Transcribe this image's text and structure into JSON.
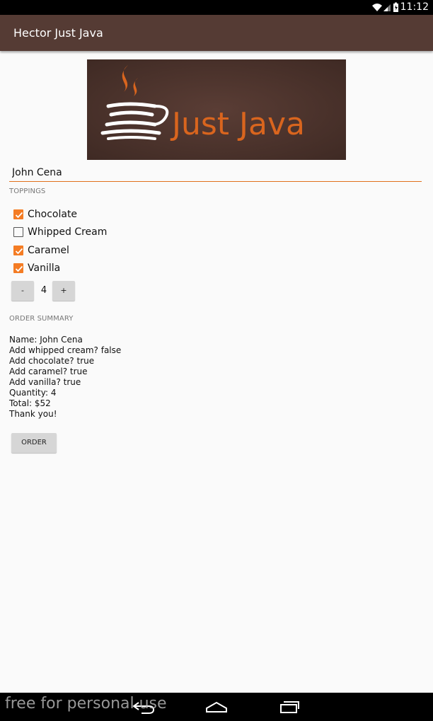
{
  "status_bar": {
    "time": "11:12",
    "icons": [
      "wifi-icon",
      "cell-signal-icon",
      "battery-icon"
    ]
  },
  "app_bar": {
    "title": "Hector Just Java",
    "color": "#553b34"
  },
  "logo": {
    "text": "Just Java",
    "icon": "coffee-cup-icon"
  },
  "name_input": {
    "value": "John Cena",
    "accent": "#e0701c"
  },
  "toppings": {
    "header": "TOPPINGS",
    "items": [
      {
        "label": "Chocolate",
        "checked": true
      },
      {
        "label": "Whipped Cream",
        "checked": false
      },
      {
        "label": "Caramel",
        "checked": true
      },
      {
        "label": "Vanilla",
        "checked": true
      }
    ]
  },
  "quantity": {
    "decrement_label": "-",
    "value": "4",
    "increment_label": "+"
  },
  "order_summary": {
    "header": "ORDER SUMMARY",
    "lines": [
      "Name: John Cena",
      "Add whipped cream? false",
      "Add chocolate? true",
      "Add caramel? true",
      "Add vanilla? true",
      "Quantity: 4",
      "Total: $52",
      "Thank you!"
    ]
  },
  "order_button": {
    "label": "ORDER"
  },
  "nav_bar": {
    "icons": [
      "back-icon",
      "home-icon",
      "recents-icon"
    ]
  },
  "watermark": "free for personal use",
  "colors": {
    "checkbox_accent": "#f47c24",
    "logo_background": "#4a3029"
  }
}
